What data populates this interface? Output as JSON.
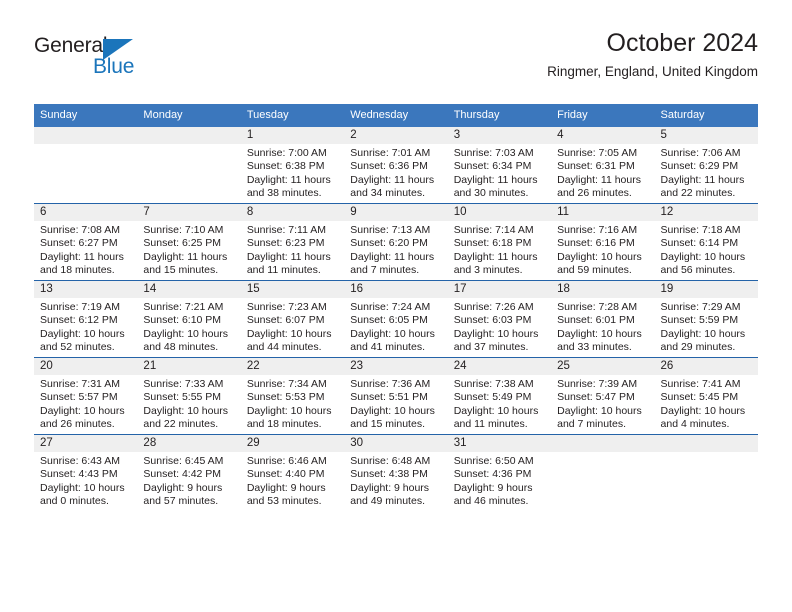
{
  "brand": {
    "name_part1": "General",
    "name_part2": "Blue",
    "accent_color": "#1b75bb"
  },
  "header": {
    "title": "October 2024",
    "subtitle": "Ringmer, England, United Kingdom"
  },
  "theme": {
    "header_blue": "#3b77bd",
    "divider_blue": "#2463a8",
    "daynum_band": "#efefef",
    "text": "#231f20"
  },
  "calendar": {
    "weekday_headers": [
      "Sunday",
      "Monday",
      "Tuesday",
      "Wednesday",
      "Thursday",
      "Friday",
      "Saturday"
    ],
    "weeks": [
      [
        {
          "day": ""
        },
        {
          "day": ""
        },
        {
          "day": "1",
          "sunrise": "Sunrise: 7:00 AM",
          "sunset": "Sunset: 6:38 PM",
          "daylight_line1": "Daylight: 11 hours",
          "daylight_line2": "and 38 minutes."
        },
        {
          "day": "2",
          "sunrise": "Sunrise: 7:01 AM",
          "sunset": "Sunset: 6:36 PM",
          "daylight_line1": "Daylight: 11 hours",
          "daylight_line2": "and 34 minutes."
        },
        {
          "day": "3",
          "sunrise": "Sunrise: 7:03 AM",
          "sunset": "Sunset: 6:34 PM",
          "daylight_line1": "Daylight: 11 hours",
          "daylight_line2": "and 30 minutes."
        },
        {
          "day": "4",
          "sunrise": "Sunrise: 7:05 AM",
          "sunset": "Sunset: 6:31 PM",
          "daylight_line1": "Daylight: 11 hours",
          "daylight_line2": "and 26 minutes."
        },
        {
          "day": "5",
          "sunrise": "Sunrise: 7:06 AM",
          "sunset": "Sunset: 6:29 PM",
          "daylight_line1": "Daylight: 11 hours",
          "daylight_line2": "and 22 minutes."
        }
      ],
      [
        {
          "day": "6",
          "sunrise": "Sunrise: 7:08 AM",
          "sunset": "Sunset: 6:27 PM",
          "daylight_line1": "Daylight: 11 hours",
          "daylight_line2": "and 18 minutes."
        },
        {
          "day": "7",
          "sunrise": "Sunrise: 7:10 AM",
          "sunset": "Sunset: 6:25 PM",
          "daylight_line1": "Daylight: 11 hours",
          "daylight_line2": "and 15 minutes."
        },
        {
          "day": "8",
          "sunrise": "Sunrise: 7:11 AM",
          "sunset": "Sunset: 6:23 PM",
          "daylight_line1": "Daylight: 11 hours",
          "daylight_line2": "and 11 minutes."
        },
        {
          "day": "9",
          "sunrise": "Sunrise: 7:13 AM",
          "sunset": "Sunset: 6:20 PM",
          "daylight_line1": "Daylight: 11 hours",
          "daylight_line2": "and 7 minutes."
        },
        {
          "day": "10",
          "sunrise": "Sunrise: 7:14 AM",
          "sunset": "Sunset: 6:18 PM",
          "daylight_line1": "Daylight: 11 hours",
          "daylight_line2": "and 3 minutes."
        },
        {
          "day": "11",
          "sunrise": "Sunrise: 7:16 AM",
          "sunset": "Sunset: 6:16 PM",
          "daylight_line1": "Daylight: 10 hours",
          "daylight_line2": "and 59 minutes."
        },
        {
          "day": "12",
          "sunrise": "Sunrise: 7:18 AM",
          "sunset": "Sunset: 6:14 PM",
          "daylight_line1": "Daylight: 10 hours",
          "daylight_line2": "and 56 minutes."
        }
      ],
      [
        {
          "day": "13",
          "sunrise": "Sunrise: 7:19 AM",
          "sunset": "Sunset: 6:12 PM",
          "daylight_line1": "Daylight: 10 hours",
          "daylight_line2": "and 52 minutes."
        },
        {
          "day": "14",
          "sunrise": "Sunrise: 7:21 AM",
          "sunset": "Sunset: 6:10 PM",
          "daylight_line1": "Daylight: 10 hours",
          "daylight_line2": "and 48 minutes."
        },
        {
          "day": "15",
          "sunrise": "Sunrise: 7:23 AM",
          "sunset": "Sunset: 6:07 PM",
          "daylight_line1": "Daylight: 10 hours",
          "daylight_line2": "and 44 minutes."
        },
        {
          "day": "16",
          "sunrise": "Sunrise: 7:24 AM",
          "sunset": "Sunset: 6:05 PM",
          "daylight_line1": "Daylight: 10 hours",
          "daylight_line2": "and 41 minutes."
        },
        {
          "day": "17",
          "sunrise": "Sunrise: 7:26 AM",
          "sunset": "Sunset: 6:03 PM",
          "daylight_line1": "Daylight: 10 hours",
          "daylight_line2": "and 37 minutes."
        },
        {
          "day": "18",
          "sunrise": "Sunrise: 7:28 AM",
          "sunset": "Sunset: 6:01 PM",
          "daylight_line1": "Daylight: 10 hours",
          "daylight_line2": "and 33 minutes."
        },
        {
          "day": "19",
          "sunrise": "Sunrise: 7:29 AM",
          "sunset": "Sunset: 5:59 PM",
          "daylight_line1": "Daylight: 10 hours",
          "daylight_line2": "and 29 minutes."
        }
      ],
      [
        {
          "day": "20",
          "sunrise": "Sunrise: 7:31 AM",
          "sunset": "Sunset: 5:57 PM",
          "daylight_line1": "Daylight: 10 hours",
          "daylight_line2": "and 26 minutes."
        },
        {
          "day": "21",
          "sunrise": "Sunrise: 7:33 AM",
          "sunset": "Sunset: 5:55 PM",
          "daylight_line1": "Daylight: 10 hours",
          "daylight_line2": "and 22 minutes."
        },
        {
          "day": "22",
          "sunrise": "Sunrise: 7:34 AM",
          "sunset": "Sunset: 5:53 PM",
          "daylight_line1": "Daylight: 10 hours",
          "daylight_line2": "and 18 minutes."
        },
        {
          "day": "23",
          "sunrise": "Sunrise: 7:36 AM",
          "sunset": "Sunset: 5:51 PM",
          "daylight_line1": "Daylight: 10 hours",
          "daylight_line2": "and 15 minutes."
        },
        {
          "day": "24",
          "sunrise": "Sunrise: 7:38 AM",
          "sunset": "Sunset: 5:49 PM",
          "daylight_line1": "Daylight: 10 hours",
          "daylight_line2": "and 11 minutes."
        },
        {
          "day": "25",
          "sunrise": "Sunrise: 7:39 AM",
          "sunset": "Sunset: 5:47 PM",
          "daylight_line1": "Daylight: 10 hours",
          "daylight_line2": "and 7 minutes."
        },
        {
          "day": "26",
          "sunrise": "Sunrise: 7:41 AM",
          "sunset": "Sunset: 5:45 PM",
          "daylight_line1": "Daylight: 10 hours",
          "daylight_line2": "and 4 minutes."
        }
      ],
      [
        {
          "day": "27",
          "sunrise": "Sunrise: 6:43 AM",
          "sunset": "Sunset: 4:43 PM",
          "daylight_line1": "Daylight: 10 hours",
          "daylight_line2": "and 0 minutes."
        },
        {
          "day": "28",
          "sunrise": "Sunrise: 6:45 AM",
          "sunset": "Sunset: 4:42 PM",
          "daylight_line1": "Daylight: 9 hours",
          "daylight_line2": "and 57 minutes."
        },
        {
          "day": "29",
          "sunrise": "Sunrise: 6:46 AM",
          "sunset": "Sunset: 4:40 PM",
          "daylight_line1": "Daylight: 9 hours",
          "daylight_line2": "and 53 minutes."
        },
        {
          "day": "30",
          "sunrise": "Sunrise: 6:48 AM",
          "sunset": "Sunset: 4:38 PM",
          "daylight_line1": "Daylight: 9 hours",
          "daylight_line2": "and 49 minutes."
        },
        {
          "day": "31",
          "sunrise": "Sunrise: 6:50 AM",
          "sunset": "Sunset: 4:36 PM",
          "daylight_line1": "Daylight: 9 hours",
          "daylight_line2": "and 46 minutes."
        },
        {
          "day": ""
        },
        {
          "day": ""
        }
      ]
    ]
  }
}
